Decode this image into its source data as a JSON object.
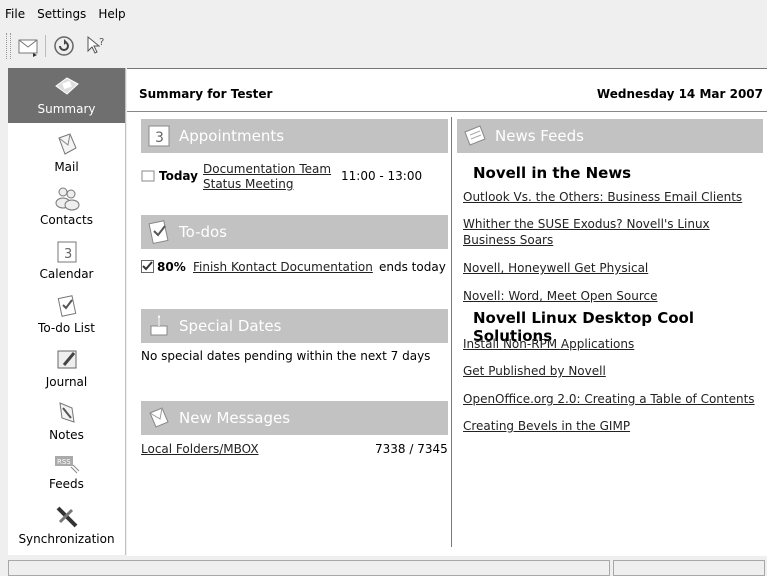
{
  "menu": {
    "file": "File",
    "settings": "Settings",
    "help": "Help"
  },
  "sidebar": {
    "items": [
      {
        "label": "Summary"
      },
      {
        "label": "Mail"
      },
      {
        "label": "Contacts"
      },
      {
        "label": "Calendar"
      },
      {
        "label": "To-do List"
      },
      {
        "label": "Journal"
      },
      {
        "label": "Notes"
      },
      {
        "label": "Feeds"
      },
      {
        "label": "Synchronization"
      }
    ]
  },
  "header": {
    "title": "Summary for Tester",
    "date": "Wednesday 14 Mar 2007"
  },
  "appointments": {
    "title": "Appointments",
    "when": "Today",
    "subject_line1": "Documentation Team",
    "subject_line2": "Status Meeting",
    "time": "11:00 - 13:00"
  },
  "todos": {
    "title": "To-dos",
    "percent": "80%",
    "item": "Finish Kontact Documentation",
    "due": "ends today"
  },
  "special": {
    "title": "Special Dates",
    "text": "No special dates pending within the next 7 days"
  },
  "messages": {
    "title": "New Messages",
    "folder": "Local Folders/MBOX",
    "count": "7338 / 7345"
  },
  "news": {
    "title": "News Feeds",
    "feeds": [
      {
        "name": "Novell in the News",
        "items": [
          "Outlook Vs. the Others: Business Email Clients",
          "Whither the SUSE Exodus? Novell's Linux",
          "Business Soars",
          "Novell, Honeywell Get Physical",
          "Novell: Word, Meet Open Source"
        ]
      },
      {
        "name": "Novell Linux Desktop Cool Solutions",
        "items": [
          "Install Non-RPM Applications",
          "Get Published by Novell",
          "OpenOffice.org 2.0: Creating a Table of Contents",
          "Creating Bevels in the GIMP"
        ]
      }
    ]
  }
}
